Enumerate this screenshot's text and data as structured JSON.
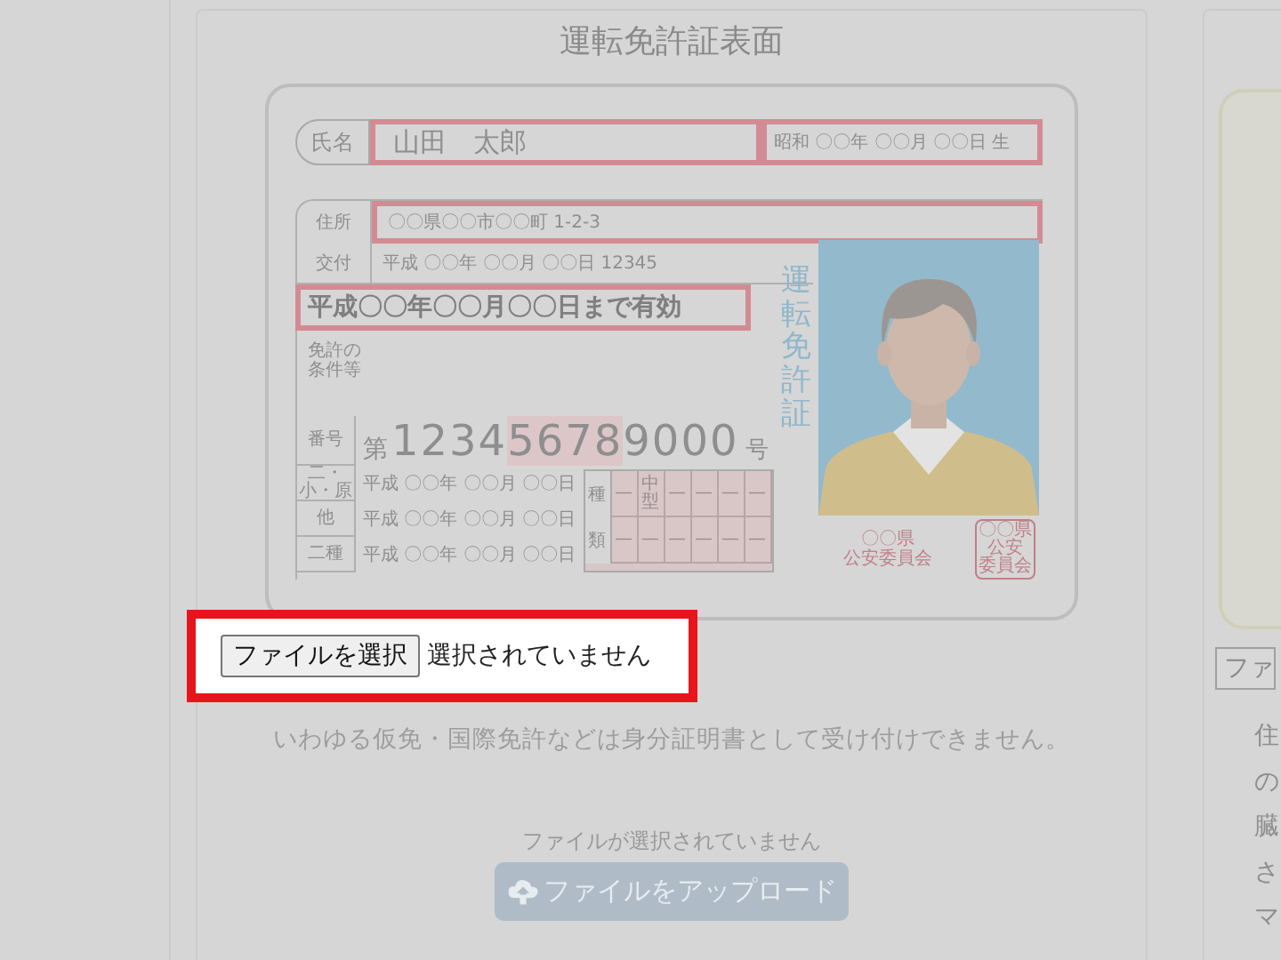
{
  "left_panel": {
    "title": "運転免許証表面",
    "license": {
      "name_label": "氏名",
      "name": "山田　太郎",
      "birth": "昭和 〇〇年 〇〇月 〇〇日 生",
      "address_label": "住所",
      "address": "〇〇県〇〇市〇〇町 1-2-3",
      "issue_label": "交付",
      "issue": "平成 〇〇年 〇〇月 〇〇日 12345",
      "expiry": "平成〇〇年〇〇月〇〇日まで有効",
      "conditions_label": "免許の条件等",
      "number_label": "番号",
      "number_prefix": "第",
      "number_head": "1234",
      "number_mark": "5678",
      "number_tail": "9000",
      "number_suffix": "号",
      "date_rows": [
        {
          "label": "二・小・原",
          "date": "平成 〇〇年 〇〇月 〇〇日"
        },
        {
          "label": "他",
          "date": "平成 〇〇年 〇〇月 〇〇日"
        },
        {
          "label": "二種",
          "date": "平成 〇〇年 〇〇月 〇〇日"
        }
      ],
      "class_table": {
        "row_labels": [
          "種",
          "類"
        ],
        "rows": [
          [
            "—",
            "中型",
            "—",
            "—",
            "—",
            "—"
          ],
          [
            "—",
            "—",
            "—",
            "—",
            "—",
            "—"
          ]
        ]
      },
      "vertical_title": "運転免許証",
      "issuer": [
        "〇〇県",
        "公安委員会"
      ],
      "stamp": [
        "〇〇県",
        "公安",
        "委員会"
      ]
    },
    "file_input": {
      "button": "ファイルを選択",
      "status": "選択されていません"
    },
    "note": "いわゆる仮免・国際免許などは身分証明書として受け付けできません。",
    "upload_status": "ファイルが選択されていません",
    "upload_button": "ファイルをアップロード"
  },
  "right_panel": {
    "file_button": "ファ",
    "lines": [
      "住",
      "の",
      "臓",
      "さ",
      "マ"
    ]
  }
}
